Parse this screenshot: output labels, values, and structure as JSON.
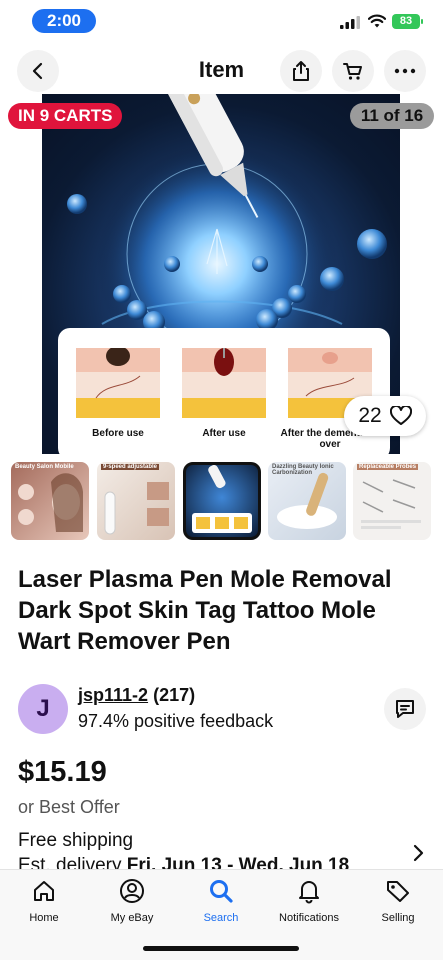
{
  "status_bar": {
    "time": "2:00",
    "battery": "83"
  },
  "header": {
    "title": "Item"
  },
  "gallery": {
    "cart_badge": "IN 9 CARTS",
    "image_counter": "11 of 16",
    "watch_count": "22",
    "skin_captions": [
      "Before use",
      "After use",
      "After the dementia is over"
    ],
    "thumbnail_labels": [
      "Beauty Salon Mobile",
      "9-speed adjustable",
      "",
      "Dazzling Beauty Ionic Carbonization",
      "Replaceable Probes"
    ],
    "selected_thumbnail": 3
  },
  "product": {
    "title": "Laser Plasma Pen Mole Removal Dark Spot Skin Tag Tattoo Mole Wart Remover Pen"
  },
  "seller": {
    "initial": "J",
    "name": "jsp111-2",
    "rating_count": "(217)",
    "feedback": "97.4% positive feedback"
  },
  "pricing": {
    "price": "$15.19",
    "offer": "or Best Offer"
  },
  "shipping": {
    "label": "Free shipping",
    "delivery_prefix": "Est. delivery ",
    "delivery_dates": "Fri, Jun 13 - Wed, Jun 18"
  },
  "bottom_nav": {
    "items": [
      {
        "label": "Home",
        "icon": "home-icon"
      },
      {
        "label": "My eBay",
        "icon": "user-icon"
      },
      {
        "label": "Search",
        "icon": "search-icon",
        "active": true
      },
      {
        "label": "Notifications",
        "icon": "bell-icon"
      },
      {
        "label": "Selling",
        "icon": "tag-icon"
      }
    ]
  },
  "colors": {
    "accent": "#1d6ff0",
    "cart_badge": "#e0143c",
    "avatar": "#c9aef0"
  }
}
